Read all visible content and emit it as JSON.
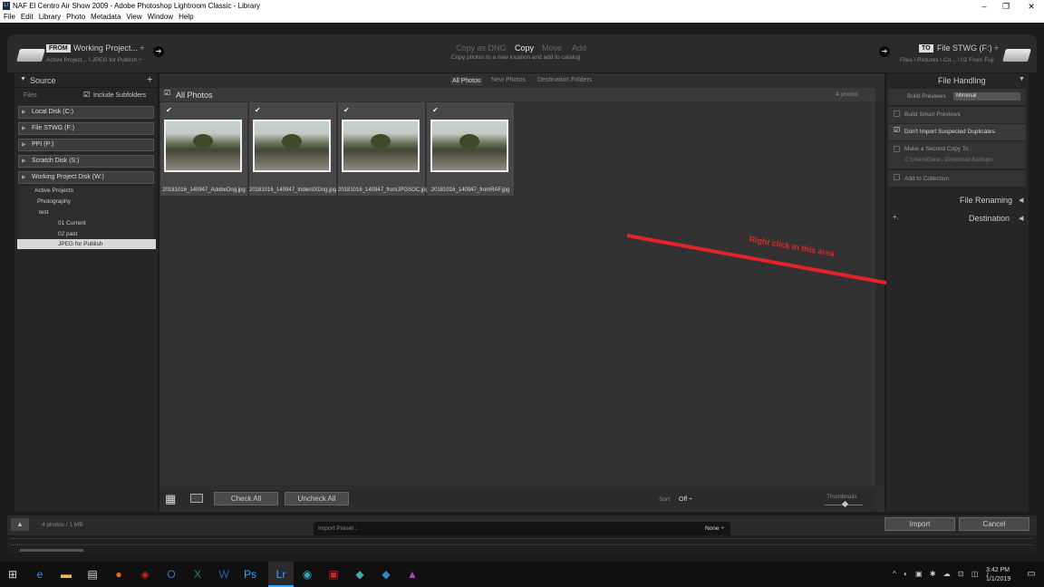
{
  "window": {
    "title": "NAF El Centro Air Show 2009 - Adobe Photoshop Lightroom Classic - Library",
    "minimize": "–",
    "restore": "❐",
    "close": "✕"
  },
  "menu": [
    "File",
    "Edit",
    "Library",
    "Photo",
    "Metadata",
    "View",
    "Window",
    "Help"
  ],
  "topbar": {
    "from_tag": "FROM",
    "from_name": "Working Project... ÷",
    "from_path": "Active Project... \\ JPEG for Publish ÷",
    "modes": [
      "Copy as DNG",
      "Copy",
      "Move",
      "Add"
    ],
    "active_mode": "Copy",
    "mode_desc": "Copy photos to a new location and add to catalog",
    "to_tag": "TO",
    "to_name": "File STWG (F:) ÷",
    "to_path": "Files \\ Pictures \\ Co... \\ 02 From Fuji"
  },
  "source": {
    "title": "Source",
    "add": "+",
    "files_label": "Files",
    "include_subfolders": "Include Subfolders",
    "volumes": [
      "Local Disk (C:)",
      "File STWG (F:)",
      "PPI (P:)",
      "Scratch Disk (S:)",
      "Working Project Disk (W:)"
    ],
    "tree": [
      "Active Projects",
      "Photography",
      "test",
      "01 Current",
      "02 past",
      "JPEG for Publish"
    ]
  },
  "center": {
    "tabs": [
      "All Photos",
      "New Photos",
      "Destination Folders"
    ],
    "header": "All Photos",
    "count": "4 photos",
    "photos": [
      "20181016_140947_AdobeDng.jpg",
      "20181016_140947_IridientXDng.jpg",
      "20181016_140947_fromJPGSOC.jpg",
      "20181016_140947_fromRAF.jpg"
    ],
    "check_all": "Check All",
    "uncheck_all": "Uncheck All",
    "sort_label": "Sort:",
    "sort_value": "Off ÷",
    "thumbnails_label": "Thumbnails",
    "annotation": "Right click in this area"
  },
  "right": {
    "file_handling": "File Handling",
    "build_previews_label": "Build Previews",
    "build_previews_value": "Minimal",
    "build_smart": "Build Smart Previews",
    "dont_import": "Don't Import Suspected Duplicates",
    "second_copy": "Make a Second Copy To :",
    "second_copy_path": "C:\\Users\\Dand...\\Download Backups",
    "add_collection": "Add to Collection",
    "file_renaming": "File Renaming",
    "destination": "Destination"
  },
  "bottom": {
    "status": "4 photos / 1 MB",
    "preset_label": "Import Preset :",
    "preset_value": "None ÷",
    "import": "Import",
    "cancel": "Cancel"
  },
  "taskbar": {
    "time": "3:42 PM",
    "date": "1/1/2019"
  },
  "colors": {
    "annotation": "#e3232a",
    "lr_blue": "#31a8ff"
  }
}
